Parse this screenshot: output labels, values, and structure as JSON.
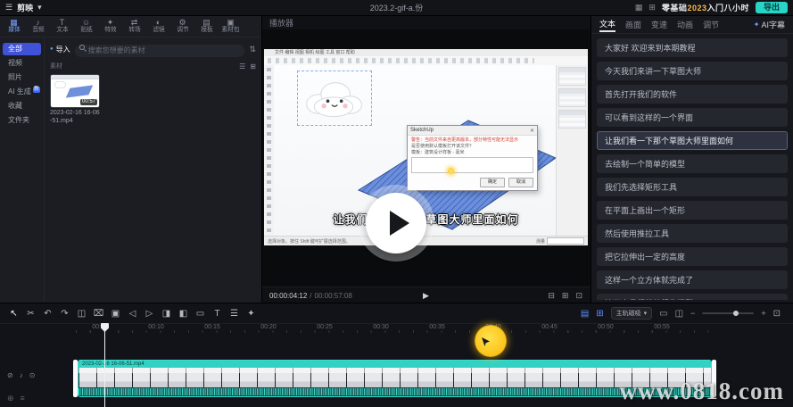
{
  "topbar": {
    "menu_icon": "☰",
    "logo": "剪映",
    "menu_caret": "▾",
    "filename": "2023.2-gif-a.份",
    "layout_icon_a": "▦",
    "layout_icon_b": "⊞",
    "promo_prefix": "零基础",
    "promo_accent": "2023",
    "promo_suffix": "入门八小时",
    "export_label": "导出"
  },
  "left_panel": {
    "ribbon": [
      {
        "icon": "▦",
        "label": "媒体",
        "active": true
      },
      {
        "icon": "♪",
        "label": "音频"
      },
      {
        "icon": "T",
        "label": "文本"
      },
      {
        "icon": "☺",
        "label": "贴纸"
      },
      {
        "icon": "✦",
        "label": "特效"
      },
      {
        "icon": "⇄",
        "label": "转场"
      },
      {
        "icon": "◐",
        "label": "滤镜"
      },
      {
        "icon": "⚙",
        "label": "调节"
      },
      {
        "icon": "▤",
        "label": "模板"
      },
      {
        "icon": "▣",
        "label": "素材包"
      }
    ],
    "import_dot": "●",
    "import_label": "导入",
    "search_placeholder": "搜索您想要的素材",
    "sort_icon": "⇅",
    "view_icon_list": "☰",
    "view_icon_grid": "⊞",
    "section_label": "素材",
    "sidebar": [
      {
        "label": "全部",
        "active": true
      },
      {
        "label": "视频"
      },
      {
        "label": "照片"
      },
      {
        "label": "AI 生成",
        "badge": "新"
      },
      {
        "label": "收藏"
      },
      {
        "label": "文件夹"
      }
    ],
    "media_item": {
      "name": "2023-02-16 16-06-51.mp4",
      "duration": "00:57"
    }
  },
  "player": {
    "title": "播放器",
    "subtitle": "让我们看一下那个草图大师里面如何",
    "current_time": "00:00:04:12",
    "time_divider": "/",
    "total_time": "00:00:57:08",
    "play_icon": "▶",
    "ctrl_icon_a": "⊟",
    "ctrl_icon_b": "⊞",
    "ctrl_icon_c": "⊡"
  },
  "app_frame": {
    "menu_text": "文件  编辑  视图  相机  绘图  工具  窗口  帮助",
    "dialog": {
      "title": "SketchUp",
      "close_icon": "✕",
      "warn_line": "警告：当前文件来自更高版本，部分特性可能无法显示",
      "body_line1": "是否使用默认模板打开该文件？",
      "body_line2": "模板：建筑设计样板 - 毫米",
      "ok": "确定",
      "cancel": "取消"
    },
    "status_text": "选择对象。按住 Shift 键可扩展选择范围。",
    "measure_label": "测量"
  },
  "right_panel": {
    "tabs": [
      {
        "label": "文本",
        "active": true
      },
      {
        "label": "画面"
      },
      {
        "label": "变速"
      },
      {
        "label": "动画"
      },
      {
        "label": "调节"
      }
    ],
    "ai_tab_icon": "✦",
    "ai_tab": "AI字幕",
    "captions": [
      {
        "text": "大家好 欢迎来到本期教程"
      },
      {
        "text": "今天我们来讲一下草图大师"
      },
      {
        "text": "首先打开我们的软件"
      },
      {
        "text": "可以看到这样的一个界面"
      },
      {
        "text": "让我们看一下那个草图大师里面如何",
        "active": true
      },
      {
        "text": "去绘制一个简单的模型"
      },
      {
        "text": "我们先选择矩形工具"
      },
      {
        "text": "在平面上画出一个矩形"
      },
      {
        "text": "然后使用推拉工具"
      },
      {
        "text": "把它拉伸出一定的高度"
      },
      {
        "text": "这样一个立方体就完成了"
      },
      {
        "text": "接下来我们继续细化模型"
      }
    ]
  },
  "timeline": {
    "tools": [
      {
        "icon": "↖",
        "name": "select"
      },
      {
        "icon": "✂",
        "name": "split"
      },
      {
        "icon": "↶",
        "name": "undo"
      },
      {
        "icon": "↷",
        "name": "redo"
      },
      {
        "icon": "◫",
        "name": "mirror"
      },
      {
        "icon": "⌧",
        "name": "delete"
      },
      {
        "icon": "▣",
        "name": "freeze"
      },
      {
        "icon": "◁",
        "name": "reverse"
      },
      {
        "icon": "▷",
        "name": "forward"
      },
      {
        "icon": "◨",
        "name": "crop"
      },
      {
        "icon": "◧",
        "name": "mask"
      },
      {
        "icon": "▭",
        "name": "speed"
      },
      {
        "icon": "T",
        "name": "text"
      },
      {
        "icon": "☰",
        "name": "tracks"
      },
      {
        "icon": "✦",
        "name": "effects"
      }
    ],
    "right": {
      "snap_icon": "▤",
      "link_icon": "⊞",
      "magnet_label": "主轨磁吸",
      "caret": "▾",
      "preview_icon": "▭",
      "split_view_icon": "◫",
      "zoom_out": "−",
      "zoom_in": "+",
      "fit_icon": "⊡"
    },
    "ruler": [
      "00:05",
      "00:10",
      "00:15",
      "00:20",
      "00:25",
      "00:30",
      "00:35",
      "00:40",
      "00:45",
      "00:50",
      "00:55"
    ],
    "rail": {
      "hide_icon": "⊘",
      "mute_icon": "♪",
      "lock_icon": "⊙",
      "add_icon": "⊕",
      "menu_icon": "≡"
    },
    "clip": {
      "label": "2023-02-16 16-06-51.mp4"
    }
  },
  "watermark": "www.0818.com"
}
